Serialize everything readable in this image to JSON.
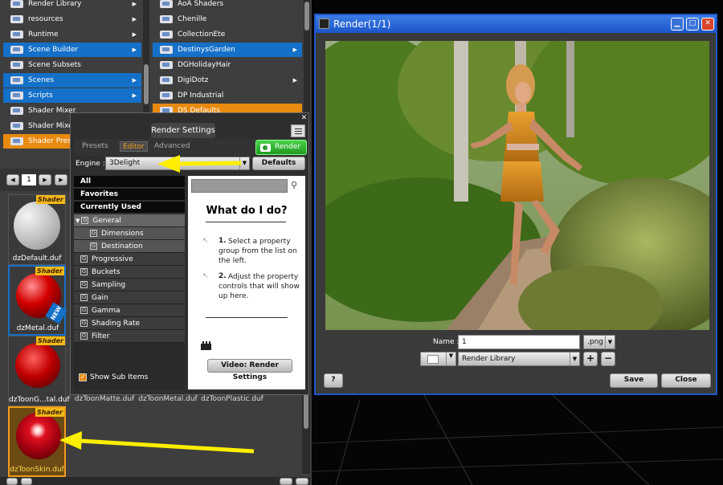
{
  "library": {
    "col1": [
      {
        "label": "Render Library",
        "state": "normal",
        "arrow": true
      },
      {
        "label": "resources",
        "state": "normal",
        "arrow": true
      },
      {
        "label": "Runtime",
        "state": "normal",
        "arrow": true
      },
      {
        "label": "Scene Builder",
        "state": "selected",
        "arrow": true
      },
      {
        "label": "Scene Subsets",
        "state": "normal",
        "arrow": false
      },
      {
        "label": "Scenes",
        "state": "selected",
        "arrow": true
      },
      {
        "label": "Scripts",
        "state": "selected",
        "arrow": true
      },
      {
        "label": "Shader Mixer",
        "state": "normal",
        "arrow": false
      },
      {
        "label": "Shader Mixer",
        "state": "normal",
        "arrow": false
      },
      {
        "label": "Shader Presets",
        "state": "orange",
        "arrow": false
      }
    ],
    "col2": [
      {
        "label": "AoA Shaders",
        "state": "normal",
        "arrow": false
      },
      {
        "label": "Chenille",
        "state": "normal",
        "arrow": false
      },
      {
        "label": "CollectionEte",
        "state": "normal",
        "arrow": false
      },
      {
        "label": "DestinysGarden",
        "state": "selected",
        "arrow": true
      },
      {
        "label": "DGHolidayHair",
        "state": "normal",
        "arrow": false
      },
      {
        "label": "DigiDotz",
        "state": "normal",
        "arrow": true
      },
      {
        "label": "DP Industrial",
        "state": "normal",
        "arrow": false
      },
      {
        "label": "DS Defaults",
        "state": "orange",
        "arrow": false
      }
    ],
    "page_number": "1",
    "thumbnails": [
      {
        "label": "dzDefault.duf",
        "tag": "Shader"
      },
      {
        "label": "dzMetal.duf",
        "tag": "Shader",
        "badge": "NEW"
      },
      {
        "label": "dzToonG...tal.duf",
        "tag": "Shader"
      },
      {
        "label": "dzToonSkin.duf",
        "tag": "Shader"
      }
    ],
    "row_labels": [
      "dzToonMatte.duf",
      "dzToonMetal.duf",
      "dzToonPlastic.duf"
    ]
  },
  "render_settings": {
    "title": "Render Settings",
    "tabs": [
      "Presets",
      "Editor",
      "Advanced"
    ],
    "active_tab": "Editor",
    "render_button": "Render",
    "engine_label": "Engine :",
    "engine_value": "3Delight",
    "defaults_button": "Defaults",
    "groups": [
      "All",
      "Favorites",
      "Currently Used"
    ],
    "properties": [
      {
        "label": "General",
        "level": 0
      },
      {
        "label": "Dimensions",
        "level": 1
      },
      {
        "label": "Destination",
        "level": 1
      },
      {
        "label": "Progressive",
        "level": 0
      },
      {
        "label": "Buckets",
        "level": 0
      },
      {
        "label": "Sampling",
        "level": 0
      },
      {
        "label": "Gain",
        "level": 0
      },
      {
        "label": "Gamma",
        "level": 0
      },
      {
        "label": "Shading Rate",
        "level": 0
      },
      {
        "label": "Filter",
        "level": 0
      }
    ],
    "show_sub_items": "Show Sub Items",
    "help_title": "What do I do?",
    "help_step1_num": "1.",
    "help_step1": "Select a property group from the list on the left.",
    "help_step2_num": "2.",
    "help_step2": "Adjust the property controls that will show up here.",
    "video_button": "Video: Render Settings"
  },
  "render_window": {
    "title": "Render(1/1)",
    "name_label": "Name :",
    "name_value": "1",
    "format_value": ".png",
    "destination_value": "Render Library",
    "add_label": "+",
    "remove_label": "−",
    "help_label": "?",
    "save_button": "Save",
    "close_button": "Close"
  },
  "colors": {
    "selection_blue": "#1470c8",
    "highlight_orange": "#e88a10",
    "annotation_arrow": "#ffee00",
    "render_green": "#2bb32b",
    "title_blue": "#1e57c8"
  }
}
